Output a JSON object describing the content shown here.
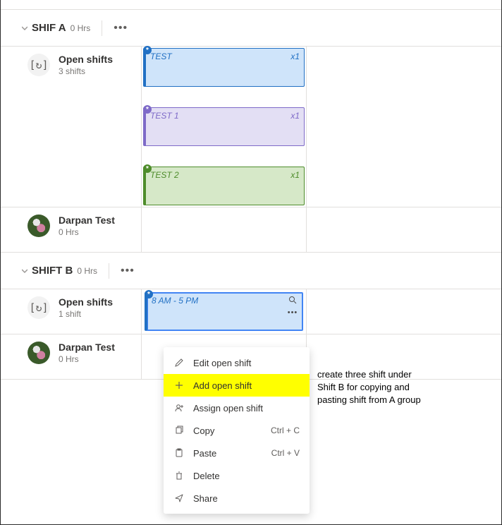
{
  "groupA": {
    "name": "SHIF A",
    "hours": "0 Hrs",
    "openShifts": {
      "title": "Open shifts",
      "subtitle": "3 shifts",
      "cards": [
        {
          "label": "TEST",
          "count": "x1",
          "color": "blue"
        },
        {
          "label": "TEST 1",
          "count": "x1",
          "color": "purple"
        },
        {
          "label": "TEST 2",
          "count": "x1",
          "color": "green"
        }
      ]
    },
    "member": {
      "name": "Darpan Test",
      "hours": "0 Hrs"
    }
  },
  "groupB": {
    "name": "SHIFT B",
    "hours": "0 Hrs",
    "openShifts": {
      "title": "Open shifts",
      "subtitle": "1 shift",
      "cards": [
        {
          "label": "8 AM - 5 PM",
          "count": "",
          "color": "selected"
        }
      ]
    },
    "member": {
      "name": "Darpan Test",
      "hours": "0 Hrs"
    }
  },
  "contextMenu": {
    "edit": "Edit open shift",
    "add": "Add open shift",
    "assign": "Assign open shift",
    "copy": "Copy",
    "copyShortcut": "Ctrl + C",
    "paste": "Paste",
    "pasteShortcut": "Ctrl + V",
    "delete": "Delete",
    "share": "Share"
  },
  "annotation": "create three shift under Shift B for copying  and pasting shift from A group"
}
